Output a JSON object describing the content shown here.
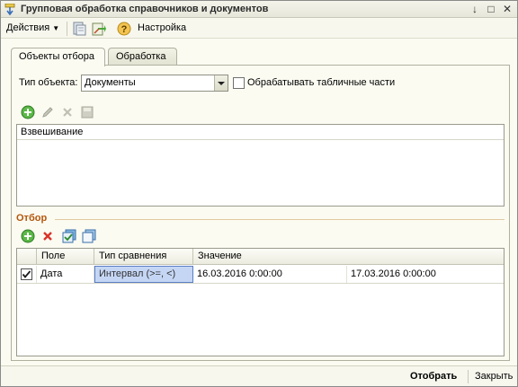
{
  "window": {
    "title": "Групповая обработка справочников и документов",
    "buttons": [
      "↓",
      "□",
      "✕"
    ]
  },
  "toolbar": {
    "actions_label": "Действия",
    "settings_label": "Настройка"
  },
  "tabs": [
    {
      "label": "Объекты отбора",
      "active": true
    },
    {
      "label": "Обработка",
      "active": false
    }
  ],
  "object_type": {
    "label": "Тип объекта:",
    "value": "Документы"
  },
  "process_tabular": {
    "label": "Обрабатывать табличные части",
    "checked": false
  },
  "objects_list": {
    "rows": [
      "Взвешивание"
    ]
  },
  "filter": {
    "title": "Отбор",
    "columns": [
      "Поле",
      "Тип сравнения",
      "Значение"
    ],
    "rows": [
      {
        "checked": true,
        "field": "Дата",
        "comparison": "Интервал (>=, <)",
        "value_from": "16.03.2016 0:00:00",
        "value_to": "17.03.2016 0:00:00"
      }
    ]
  },
  "footer": {
    "select_label": "Отобрать",
    "close_label": "Закрыть"
  },
  "colors": {
    "accent": "#b4560b",
    "selection": "#c5d6f5"
  }
}
